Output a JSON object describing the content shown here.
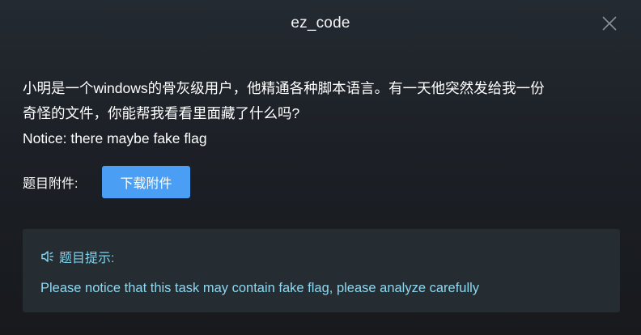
{
  "dialog": {
    "title": "ez_code",
    "close_icon": "close-icon"
  },
  "description": {
    "line1": "小明是一个windows的骨灰级用户，他精通各种脚本语言。有一天他突然发给我一份",
    "line2": "奇怪的文件，你能帮我看看里面藏了什么吗?",
    "line3": "Notice: there maybe fake flag"
  },
  "attachment": {
    "label": "题目附件:",
    "button_label": "下载附件",
    "button_color": "#4a9ff5"
  },
  "hint": {
    "icon": "speaker-icon",
    "title": "题目提示:",
    "text": "Please notice that this task may contain fake flag, please analyze carefully",
    "accent_color": "#7fd3ee"
  }
}
